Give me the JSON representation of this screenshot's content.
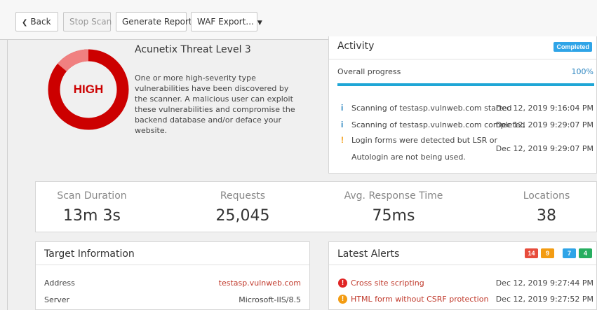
{
  "toolbar": {
    "back_label": "Back",
    "stop_scan_label": "Stop Scan",
    "generate_report_label": "Generate Report",
    "waf_export_label": "WAF Export..."
  },
  "threat": {
    "level_text": "HIGH",
    "title": "Acunetix Threat Level 3",
    "description": "One or more high-severity type vulnerabilities have been discovered by the scanner. A malicious user can exploit these vulnerabilities and compromise the backend database and/or deface your website.",
    "color": "#cc0000",
    "accent_color": "#f08080"
  },
  "activity": {
    "title": "Activity",
    "status_badge": "Completed",
    "progress_label": "Overall progress",
    "progress_value": "100%",
    "progress_fraction": 1.0,
    "events": [
      {
        "icon": "info-icon",
        "text": "Scanning of testasp.vulnweb.com started",
        "time": "Dec 12, 2019 9:16:04 PM"
      },
      {
        "icon": "info-icon",
        "text": "Scanning of testasp.vulnweb.com completed",
        "time": "Dec 12, 2019 9:29:07 PM"
      },
      {
        "icon": "warning-icon",
        "text_line1": "Login forms were detected but LSR or",
        "text_line2": "Autologin are not being used.",
        "time": "Dec 12, 2019 9:29:07 PM"
      }
    ]
  },
  "stats": {
    "scan_duration_label": "Scan Duration",
    "scan_duration_value": "13m 3s",
    "requests_label": "Requests",
    "requests_value": "25,045",
    "response_time_label": "Avg. Response Time",
    "response_time_value": "75ms",
    "locations_label": "Locations",
    "locations_value": "38"
  },
  "target": {
    "title": "Target Information",
    "rows": [
      {
        "key": "Address",
        "value": "testasp.vulnweb.com"
      },
      {
        "key": "Server",
        "value": "Microsoft-IIS/8.5"
      }
    ]
  },
  "alerts": {
    "title": "Latest Alerts",
    "counts": [
      {
        "value": "14",
        "color": "#e74c3c"
      },
      {
        "value": "9",
        "color": "#f39c12"
      },
      {
        "value": "7",
        "color": "#2fa4e7"
      },
      {
        "value": "4",
        "color": "#27ae60"
      }
    ],
    "items": [
      {
        "icon": "high-severity-icon",
        "name": "Cross site scripting",
        "time": "Dec 12, 2019 9:27:44 PM",
        "color": "#e02424"
      },
      {
        "icon": "medium-severity-icon",
        "name": "HTML form without CSRF protection",
        "time": "Dec 12, 2019 9:27:52 PM",
        "color": "#f39c12"
      }
    ]
  }
}
